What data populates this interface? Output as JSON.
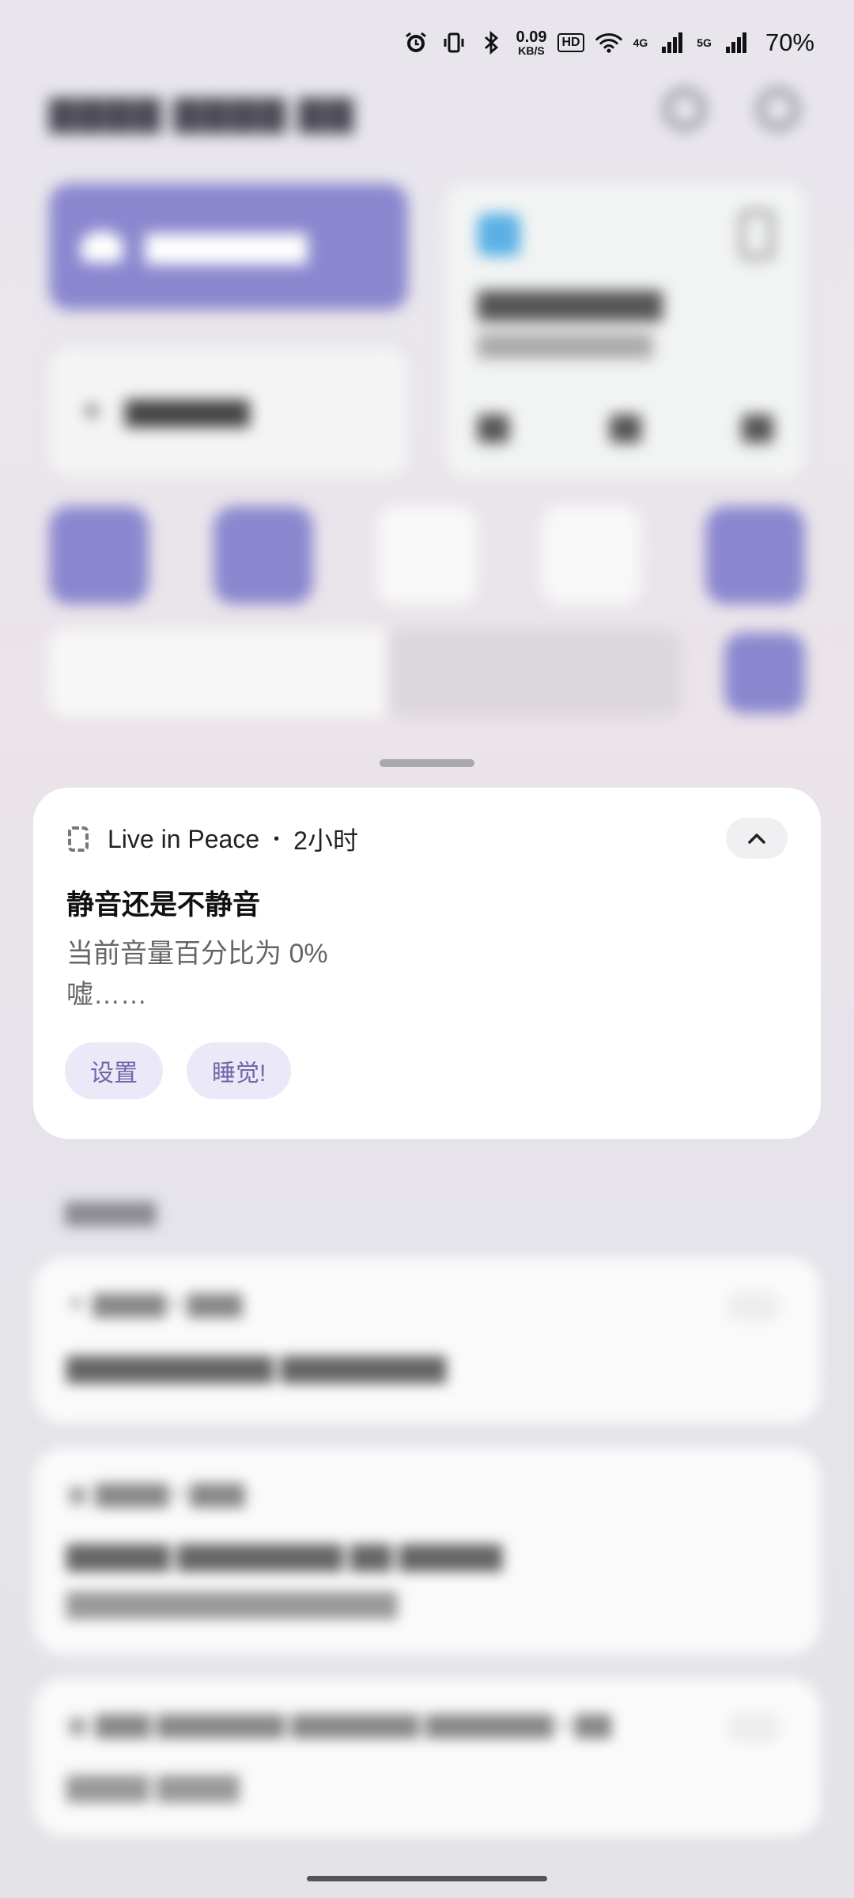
{
  "status_bar": {
    "net_speed_value": "0.09",
    "net_speed_unit": "KB/S",
    "hd_label": "HD",
    "net_4g": "4G",
    "net_5g": "5G",
    "battery": "70%"
  },
  "notification": {
    "app_name": "Live in Peace",
    "time": "2小时",
    "title": "静音还是不静音",
    "body_line1": "当前音量百分比为 0%",
    "body_line2": "嘘……",
    "actions": [
      "设置",
      "睡觉!"
    ]
  },
  "icons": {
    "alarm": "alarm-icon",
    "vibrate": "vibrate-icon",
    "bluetooth": "bluetooth-icon",
    "wifi": "wifi-icon",
    "signal": "signal-icon",
    "collapse": "chevron-up-icon"
  },
  "colors": {
    "accent": "#8b87cf",
    "action_bg": "#ebe9f8",
    "action_text": "#6e68a8"
  }
}
